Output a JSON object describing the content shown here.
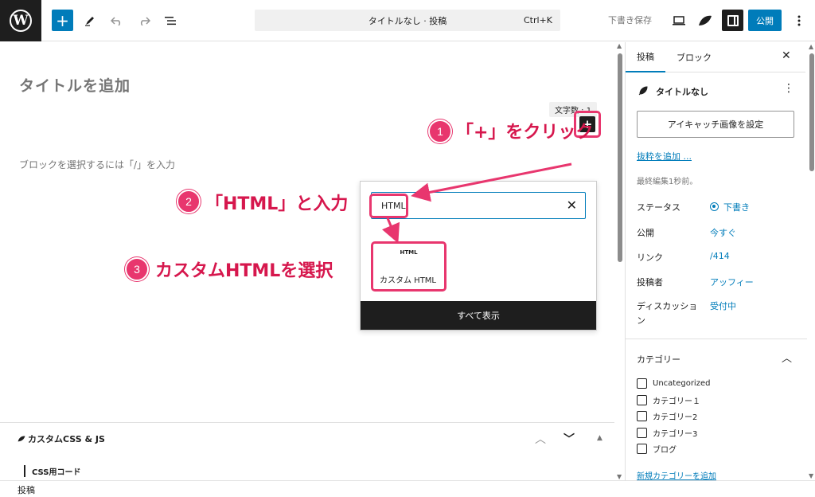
{
  "toolbar": {
    "logo": "W",
    "add_icon": "+",
    "command_title": "タイトルなし · 投稿",
    "command_shortcut": "Ctrl+K",
    "save_draft": "下書き保存",
    "publish": "公開"
  },
  "editor": {
    "title_placeholder": "タイトルを追加",
    "word_count": "文字数 : 1",
    "block_placeholder": "ブロックを選択するには「/」を入力"
  },
  "inserter": {
    "search_value": "HTML",
    "result_icon": "HTML",
    "result_label": "カスタム HTML",
    "browse_all": "すべて表示"
  },
  "annotations": {
    "step1_num": "1",
    "step1_text": "「+」をクリック",
    "step2_num": "2",
    "step2_text": "「HTML」と入力",
    "step3_num": "3",
    "step3_text": "カスタムHTMLを選択",
    "color": "#e8366e"
  },
  "metabox": {
    "title": "カスタムCSS & JS",
    "css_label": "CSS用コード"
  },
  "footer": {
    "breadcrumb": "投稿"
  },
  "sidebar": {
    "tab_post": "投稿",
    "tab_block": "ブロック",
    "doc_title": "タイトルなし",
    "featured_image": "アイキャッチ画像を設定",
    "excerpt_link": "抜粋を追加 ...",
    "last_edited": "最終編集1秒前。",
    "status_label": "ステータス",
    "status_value": "下書き",
    "publish_label": "公開",
    "publish_value": "今すぐ",
    "link_label": "リンク",
    "link_value": "/414",
    "author_label": "投稿者",
    "author_value": "アッフィー",
    "discussion_label": "ディスカッション",
    "discussion_value": "受付中",
    "categories_title": "カテゴリー",
    "categories": [
      "Uncategorized",
      "カテゴリー１",
      "カテゴリー2",
      "カテゴリー3",
      "ブログ"
    ],
    "add_category": "新規カテゴリーを追加"
  },
  "colors": {
    "accent": "#007cba",
    "annotation": "#e8366e",
    "dark": "#1e1e1e"
  }
}
